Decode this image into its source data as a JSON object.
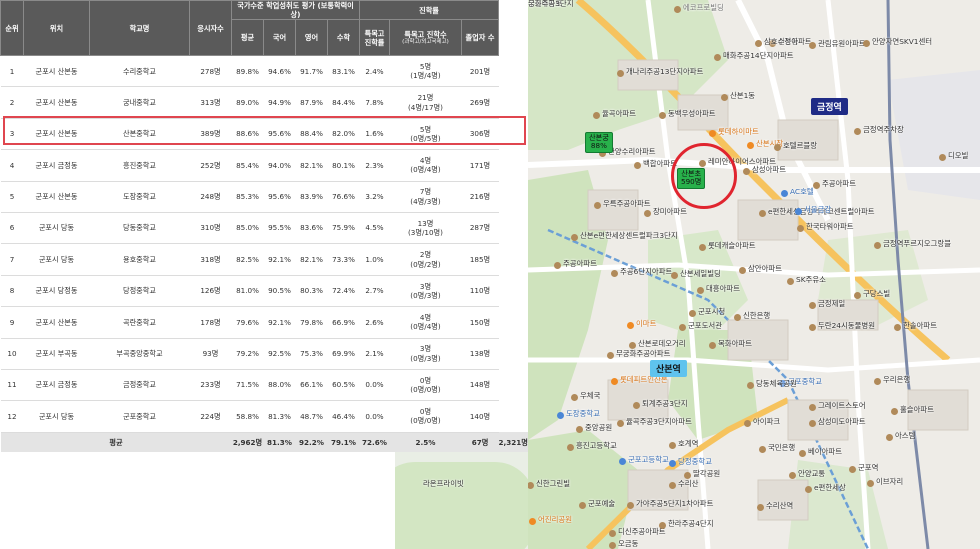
{
  "table": {
    "headers": {
      "no": "순위",
      "loc": "위치",
      "school": "학교명",
      "students": "응시자수",
      "national_group": "국가수준 학업성취도 평가 (보통학력이상)",
      "avg": "평균",
      "kor": "국어",
      "eng": "영어",
      "math": "수학",
      "adv_group": "진학률",
      "sci_rate": "특목고 진학률",
      "sci_count": "특목고 진학수",
      "sci_count_sub": "(과학고/외고국제고)",
      "grads": "졸업자 수"
    },
    "rows": [
      {
        "no": "1",
        "loc": "군포시 산본동",
        "school": "수리중학교",
        "students": "278명",
        "avg": "89.8%",
        "kor": "94.6%",
        "eng": "91.7%",
        "math": "83.1%",
        "rate": "2.4%",
        "cnt1": "5명",
        "cnt2": "(1명/4명)",
        "grads": "201명"
      },
      {
        "no": "2",
        "loc": "군포시 산본동",
        "school": "궁내중학교",
        "students": "313명",
        "avg": "89.0%",
        "kor": "94.9%",
        "eng": "87.9%",
        "math": "84.4%",
        "rate": "7.8%",
        "cnt1": "21명",
        "cnt2": "(4명/17명)",
        "grads": "269명"
      },
      {
        "no": "3",
        "loc": "군포시 산본동",
        "school": "산본중학교",
        "students": "389명",
        "avg": "88.6%",
        "kor": "95.6%",
        "eng": "88.4%",
        "math": "82.0%",
        "rate": "1.6%",
        "cnt1": "5명",
        "cnt2": "(0명/5명)",
        "grads": "306명"
      },
      {
        "no": "4",
        "loc": "군포시 금정동",
        "school": "흥진중학교",
        "students": "252명",
        "avg": "85.4%",
        "kor": "94.0%",
        "eng": "82.1%",
        "math": "80.1%",
        "rate": "2.3%",
        "cnt1": "4명",
        "cnt2": "(0명/4명)",
        "grads": "171명"
      },
      {
        "no": "5",
        "loc": "군포시 산본동",
        "school": "도장중학교",
        "students": "248명",
        "avg": "85.3%",
        "kor": "95.6%",
        "eng": "83.9%",
        "math": "76.6%",
        "rate": "3.2%",
        "cnt1": "7명",
        "cnt2": "(4명/3명)",
        "grads": "216명"
      },
      {
        "no": "6",
        "loc": "군포시 당동",
        "school": "당동중학교",
        "students": "310명",
        "avg": "85.0%",
        "kor": "95.5%",
        "eng": "83.6%",
        "math": "75.9%",
        "rate": "4.5%",
        "cnt1": "13명",
        "cnt2": "(3명/10명)",
        "grads": "287명"
      },
      {
        "no": "7",
        "loc": "군포시 당동",
        "school": "용호중학교",
        "students": "318명",
        "avg": "82.5%",
        "kor": "92.1%",
        "eng": "82.1%",
        "math": "73.3%",
        "rate": "1.0%",
        "cnt1": "2명",
        "cnt2": "(0명/2명)",
        "grads": "185명"
      },
      {
        "no": "8",
        "loc": "군포시 당정동",
        "school": "당정중학교",
        "students": "126명",
        "avg": "81.0%",
        "kor": "90.5%",
        "eng": "80.3%",
        "math": "72.4%",
        "rate": "2.7%",
        "cnt1": "3명",
        "cnt2": "(0명/3명)",
        "grads": "110명"
      },
      {
        "no": "9",
        "loc": "군포시 산본동",
        "school": "곡란중학교",
        "students": "178명",
        "avg": "79.6%",
        "kor": "92.1%",
        "eng": "79.8%",
        "math": "66.9%",
        "rate": "2.6%",
        "cnt1": "4명",
        "cnt2": "(0명/4명)",
        "grads": "150명"
      },
      {
        "no": "10",
        "loc": "군포시 부곡동",
        "school": "부곡중앙중학교",
        "students": "93명",
        "avg": "79.2%",
        "kor": "92.5%",
        "eng": "75.3%",
        "math": "69.9%",
        "rate": "2.1%",
        "cnt1": "3명",
        "cnt2": "(0명/3명)",
        "grads": "138명"
      },
      {
        "no": "11",
        "loc": "군포시 금정동",
        "school": "금정중학교",
        "students": "233명",
        "avg": "71.5%",
        "kor": "88.0%",
        "eng": "66.1%",
        "math": "60.5%",
        "rate": "0.0%",
        "cnt1": "0명",
        "cnt2": "(0명/0명)",
        "grads": "148명"
      },
      {
        "no": "12",
        "loc": "군포시 당동",
        "school": "군포중학교",
        "students": "224명",
        "avg": "58.8%",
        "kor": "81.3%",
        "eng": "48.7%",
        "math": "46.4%",
        "rate": "0.0%",
        "cnt1": "0명",
        "cnt2": "(0명/0명)",
        "grads": "140명"
      }
    ],
    "average": {
      "label": "평균",
      "students": "2,962명",
      "avg": "81.3%",
      "kor": "92.2%",
      "eng": "79.1%",
      "math": "72.6%",
      "rate": "2.5%",
      "cnt": "67명",
      "grads": "2,321명"
    }
  },
  "map": {
    "stations": {
      "geumjeong": "금정역",
      "sanbon": "산본역"
    },
    "tags": {
      "gungnae": {
        "name": "산본궁",
        "pct": "88%"
      },
      "sanbon": {
        "name": "산본초",
        "count": "590명"
      }
    },
    "labels": [
      "산본동",
      "에코프로빌딩",
      "매화주공14단지아파트",
      "개나리주공13단지아파트",
      "동백우성아파트",
      "율곡아파트",
      "삼호수정아파트",
      "관림유원아파트",
      "안양자연SKV1센터",
      "롯데하이마트",
      "산본1동",
      "한양수리아파트",
      "백합아파트",
      "레미안하이어스아파트",
      "산본시장",
      "호텔르블랑",
      "삼성아파트",
      "주공아파트",
      "우륵주공아파트",
      "장미아파트",
      "e편한세상금정역에코센트럴아파트",
      "AC호텔",
      "서울금강",
      "한국타워아파트",
      "금정역주차장",
      "디오빌",
      "산본e편한세상센트럴파크3단지",
      "주공6단지아파트",
      "롯데캐슬아파트",
      "산본세일빌딩",
      "금정역푸르지오그랑블",
      "삼안아파트",
      "SK주유소",
      "주공아파트",
      "대흥아파트",
      "군포시청",
      "군포도서관",
      "신한은행",
      "금정제일",
      "구당스빌",
      "한솔아파트",
      "이마트",
      "산본로데오거리",
      "두란24시동물병원",
      "무궁화주공아파트",
      "목화아파트",
      "군포중학교",
      "롯데피트인산본",
      "우체국",
      "중앙공원",
      "도장중학교",
      "퇴계주공3단지",
      "율곡주공3단지아파트",
      "호계역",
      "당정중학교",
      "군포고등학교",
      "흥진고등학교",
      "딸각공원",
      "아이파크",
      "당동체육공원",
      "삼성미도아파트",
      "우리은행",
      "그레이트스토어",
      "홀슬아파트",
      "아스템",
      "군포역",
      "안양교통",
      "국민은행",
      "베이아파트",
      "e편한세상",
      "이브자리",
      "신한그린빌",
      "라온프라이빗",
      "수리산",
      "가야주공5단지1차아파트",
      "어진리공원",
      "디신주공아파트",
      "군포예술",
      "오금동",
      "수리산역",
      "한라주공4단지",
      "우진아파트",
      "궁화주공3단지"
    ]
  }
}
